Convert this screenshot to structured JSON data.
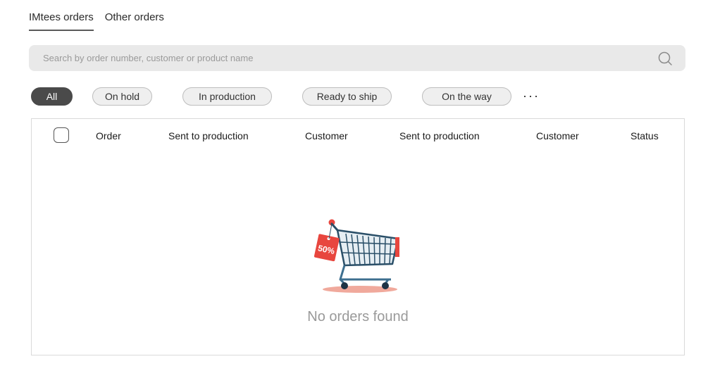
{
  "tabs": [
    {
      "label": "IMtees orders",
      "active": true
    },
    {
      "label": "Other orders",
      "active": false
    }
  ],
  "search": {
    "placeholder": "Search by order number, customer or product name",
    "value": "",
    "icon": "search-icon"
  },
  "filters": {
    "chips": [
      {
        "label": "All",
        "active": true
      },
      {
        "label": "On hold",
        "active": false
      },
      {
        "label": "In production",
        "active": false
      },
      {
        "label": "Ready to ship",
        "active": false
      },
      {
        "label": "On the way",
        "active": false
      }
    ],
    "more_label": "···"
  },
  "table": {
    "columns": [
      "Order",
      "Sent to production",
      "Customer",
      "Sent to production",
      "Customer",
      "Status"
    ],
    "rows": [],
    "empty_state": {
      "message": "No orders found",
      "illustration": "shopping-cart-icon",
      "tag_text": "50%"
    }
  },
  "colors": {
    "accent_dark": "#4a4a4a",
    "search_bg": "#e9e9e9",
    "tag_red": "#e8463e",
    "cart_blue": "#3d6f8f"
  }
}
